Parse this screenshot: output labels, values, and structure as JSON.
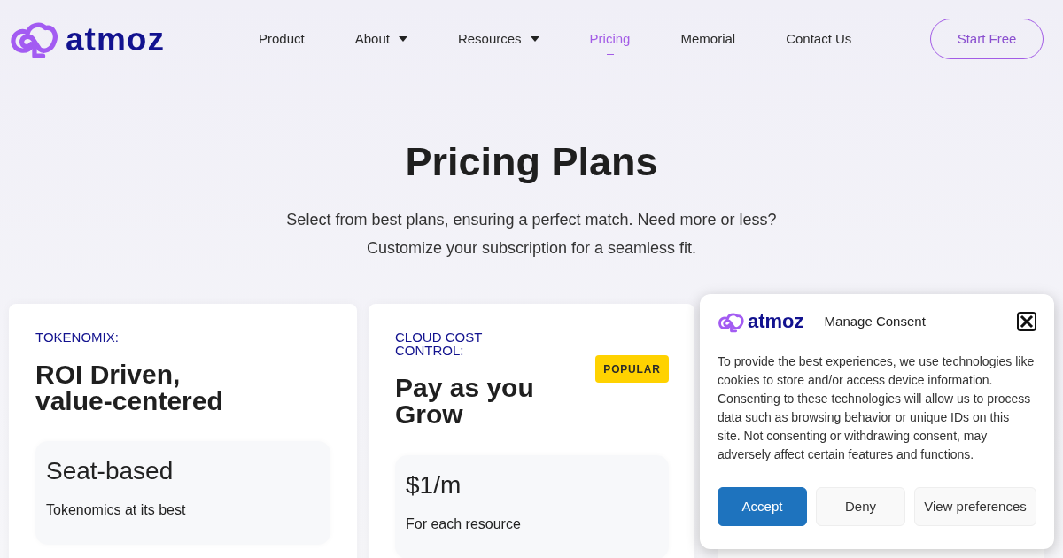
{
  "header": {
    "logo": "atmoz",
    "nav": [
      {
        "label": "Product",
        "dropdown": false,
        "selected": false
      },
      {
        "label": "About",
        "dropdown": true,
        "selected": false
      },
      {
        "label": "Resources",
        "dropdown": true,
        "selected": false
      },
      {
        "label": "Pricing",
        "dropdown": false,
        "selected": true
      },
      {
        "label": "Memorial",
        "dropdown": false,
        "selected": false
      },
      {
        "label": "Contact Us",
        "dropdown": false,
        "selected": false
      }
    ],
    "cta": "Start Free"
  },
  "hero": {
    "title": "Pricing Plans",
    "subtitle_lines": [
      "Select from best plans, ensuring a perfect match. Need more or less?",
      "Customize your subscription for a seamless fit."
    ]
  },
  "plans": [
    {
      "eyebrow": "TOKENOMIX:",
      "title": "ROI Driven, value-centered",
      "price": "Seat-based",
      "note": "Tokenomics at its best"
    },
    {
      "eyebrow": "CLOUD COST CONTROL:",
      "badge": "POPULAR",
      "title": "Pay as you Grow",
      "price": "$1/m",
      "note": "For each resource"
    }
  ],
  "consent": {
    "logo": "atmoz",
    "title": "Manage Consent",
    "body": "To provide the best experiences, we use technologies like cookies to store and/or access device information. Consenting to these technologies will allow us to process data such as browsing behavior or unique IDs on this site. Not consenting or withdrawing consent, may adversely affect certain features and functions.",
    "buttons": [
      {
        "label": "Accept",
        "kind": "primary"
      },
      {
        "label": "Deny",
        "kind": "secondary"
      },
      {
        "label": "View preferences",
        "kind": "secondary"
      }
    ]
  }
}
